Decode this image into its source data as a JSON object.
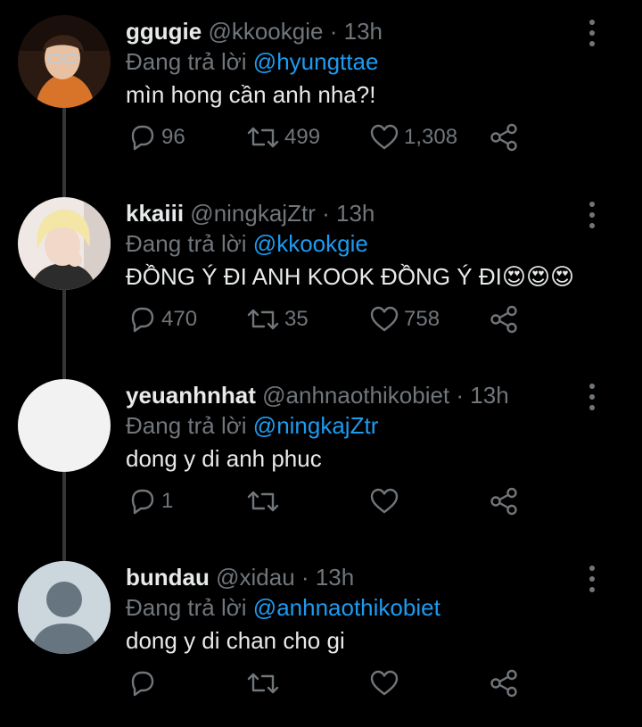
{
  "tweets": [
    {
      "display_name": "ggugie",
      "handle": "@kkookgie",
      "separator": "·",
      "time": "13h",
      "reply_prefix": "Đang trả lời",
      "reply_to": "@hyungttae",
      "text": "mìn hong cần anh nha?!",
      "reply_count": "96",
      "retweet_count": "499",
      "like_count": "1,308",
      "avatar_type": "photo"
    },
    {
      "display_name": "kkaiii",
      "handle": "@ningkajZtr",
      "separator": "·",
      "time": "13h",
      "reply_prefix": "Đang trả lời",
      "reply_to": "@kkookgie",
      "text": "ĐỒNG Ý ĐI ANH KOOK ĐỒNG Ý ĐI😍😍😍",
      "reply_count": "470",
      "retweet_count": "35",
      "like_count": "758",
      "avatar_type": "photo"
    },
    {
      "display_name": "yeuanhnhat",
      "handle": "@anhnaothikobiet",
      "separator": "·",
      "time": "13h",
      "reply_prefix": "Đang trả lời",
      "reply_to": "@ningkajZtr",
      "text": "dong y di anh phuc",
      "reply_count": "1",
      "retweet_count": "",
      "like_count": "",
      "avatar_type": "blank"
    },
    {
      "display_name": "bundau",
      "handle": "@xidau",
      "separator": "·",
      "time": "13h",
      "reply_prefix": "Đang trả lời",
      "reply_to": "@anhnaothikobiet",
      "text": "dong y di chan cho gi",
      "reply_count": "",
      "retweet_count": "",
      "like_count": "",
      "avatar_type": "default"
    }
  ],
  "icons": {
    "reply": "reply-icon",
    "retweet": "retweet-icon",
    "like": "heart-icon",
    "share": "share-icon",
    "more": "more-vertical-icon"
  },
  "colors": {
    "background": "#000000",
    "text": "#e7e9ea",
    "muted": "#71767b",
    "mention": "#1d9bf0",
    "thread_line": "#333639"
  }
}
